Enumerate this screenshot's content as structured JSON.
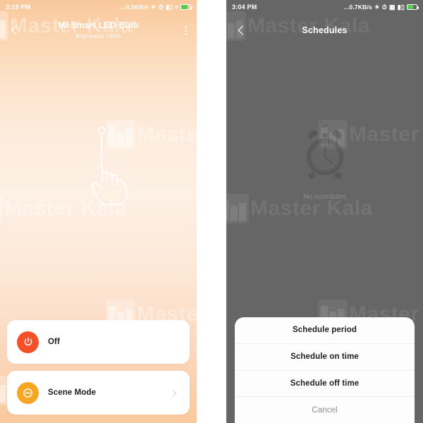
{
  "left_screen": {
    "status_bar": {
      "time": "3:19 PM",
      "network_speed": "...0.5KB/s",
      "icons": [
        "bluetooth-icon",
        "alarm-icon",
        "signal-icon",
        "wifi-icon",
        "battery-icon"
      ]
    },
    "app_bar": {
      "back_label": "back-chevron",
      "title": "Mi Smart LED Bulb",
      "subtitle": "Brightness 100%",
      "menu_label": "more-options"
    },
    "gesture_hint": "swipe-up-hand-pointer",
    "cards": [
      {
        "label": "Off",
        "icon": "power-icon",
        "color": "#f4502a",
        "has_chevron": false
      },
      {
        "label": "Scene Mode",
        "icon": "scene-wave-icon",
        "color": "#f5a623",
        "has_chevron": true
      }
    ]
  },
  "right_screen": {
    "status_bar": {
      "time": "3:04 PM",
      "network_speed": "...0.7KB/s",
      "icons": [
        "bluetooth-icon",
        "alarm-icon",
        "sim-icon",
        "signal-icon",
        "battery-icon"
      ]
    },
    "app_bar": {
      "back_label": "back-chevron",
      "title": "Schedules"
    },
    "empty_state": {
      "icon": "alarm-clock-icon",
      "label": "No schedules"
    },
    "action_sheet": {
      "items": [
        {
          "label": "Schedule period"
        },
        {
          "label": "Schedule on time"
        },
        {
          "label": "Schedule off time"
        }
      ],
      "cancel_label": "Cancel"
    }
  },
  "watermark": {
    "text": "Master Kala"
  },
  "colors": {
    "accent_off": "#f4502a",
    "accent_scene": "#f5a623",
    "left_bg_top": "#f9c89c",
    "left_bg_mid": "#fdf0e4",
    "right_bg": "#666666",
    "sheet_bg": "#fdfdfd"
  }
}
